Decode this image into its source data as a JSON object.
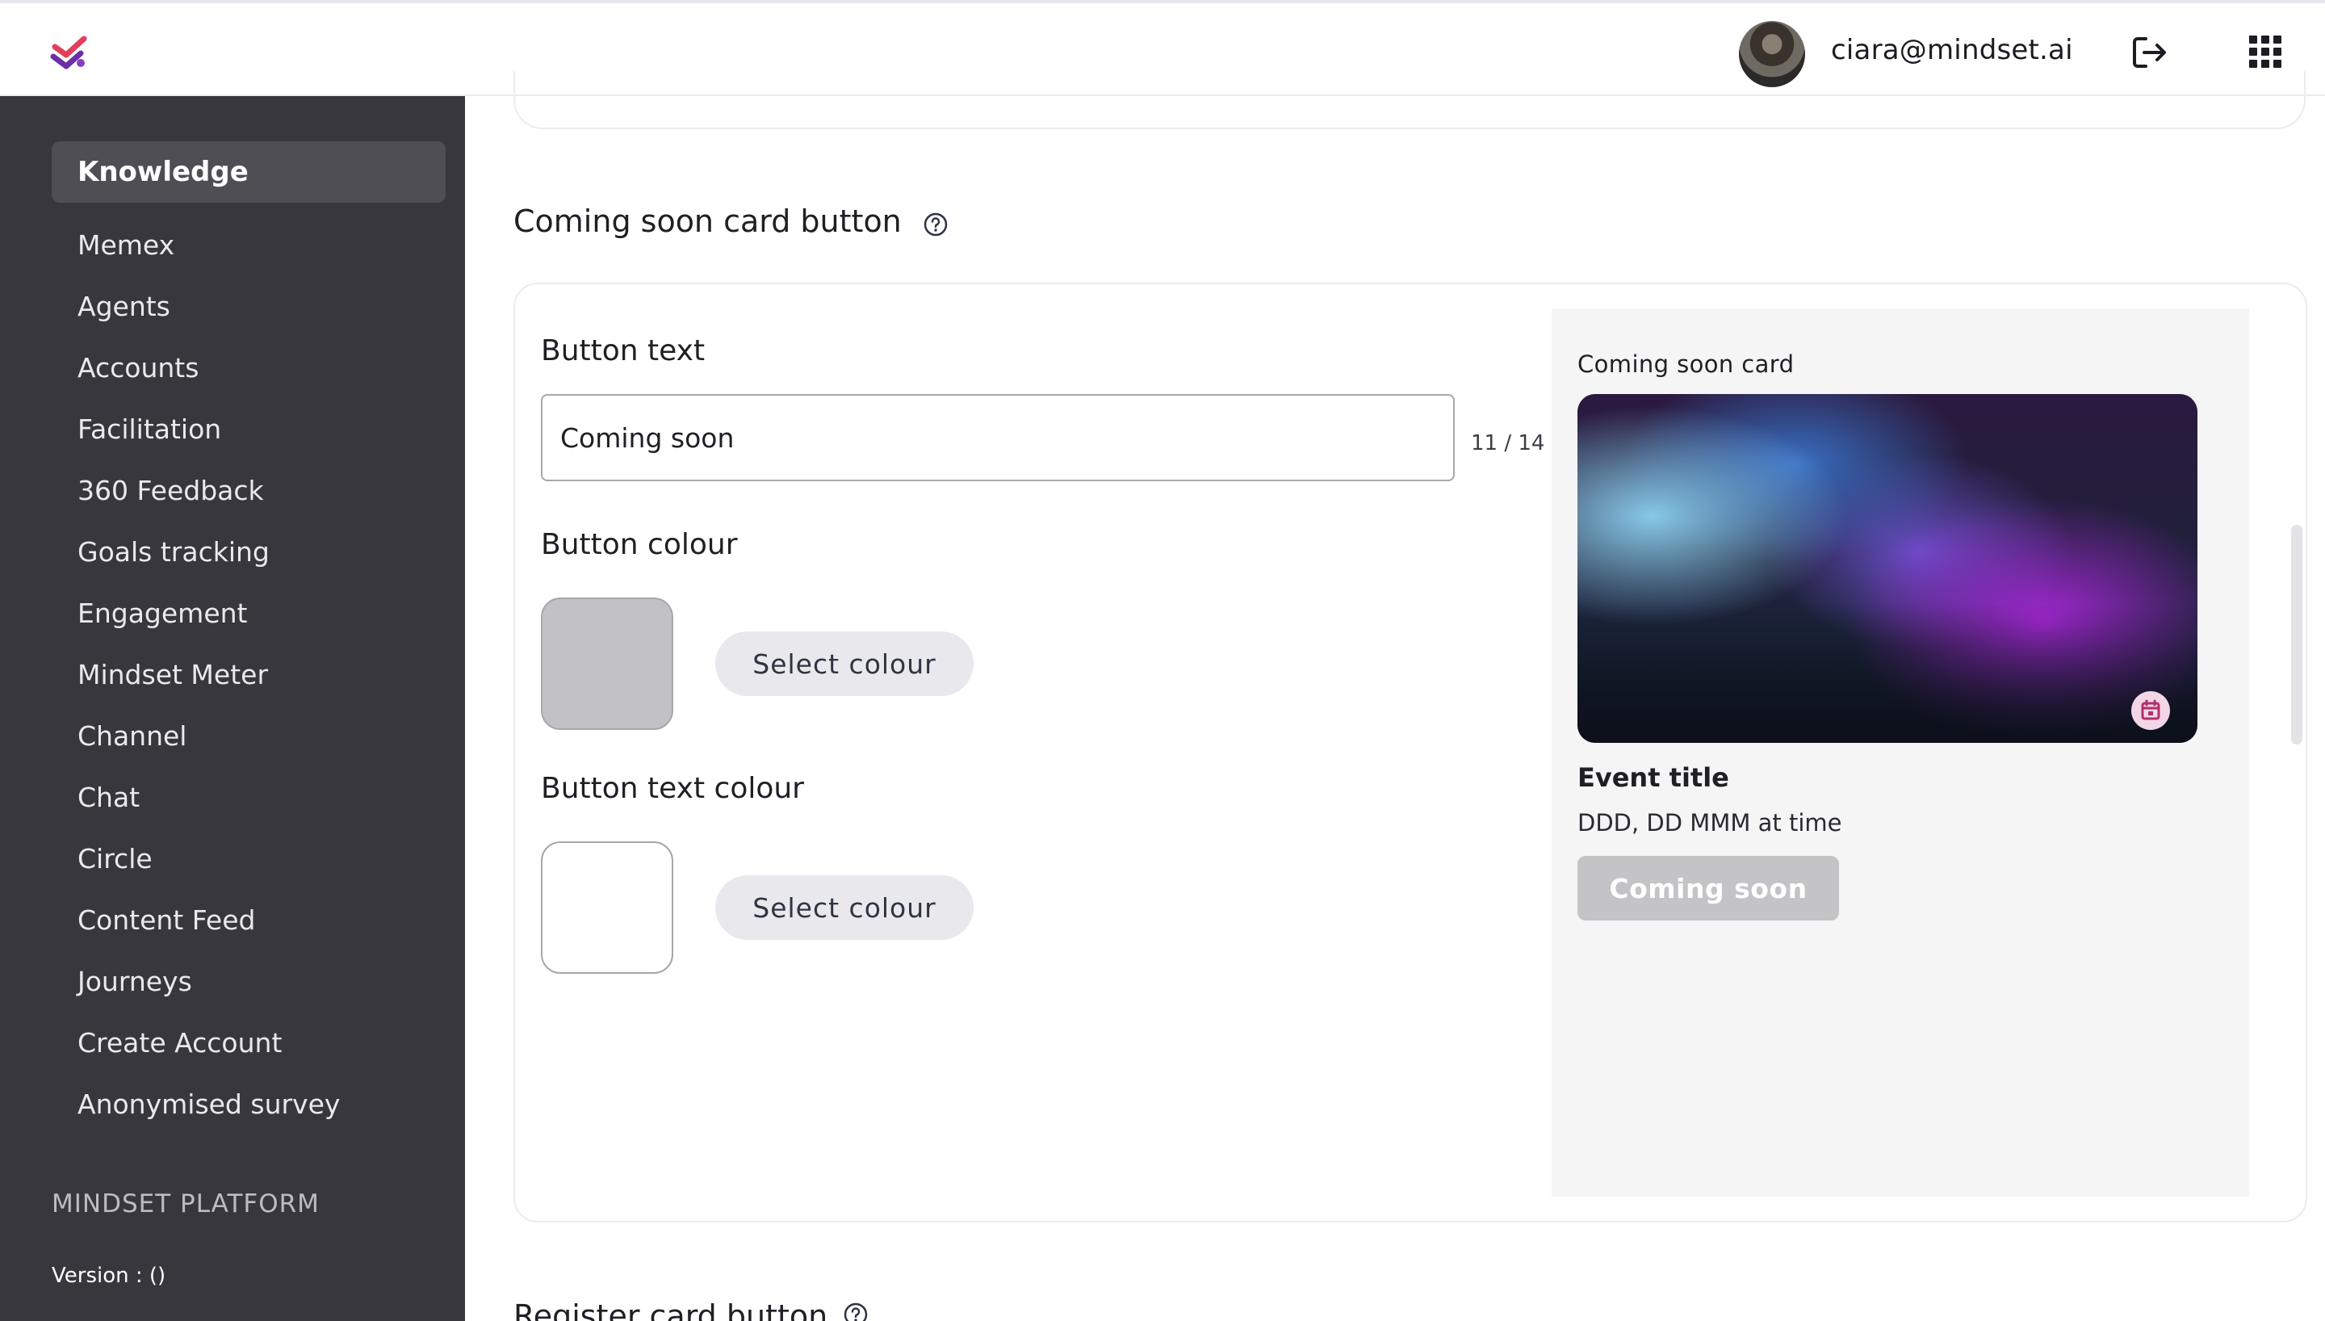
{
  "header": {
    "user_email": "ciara@mindset.ai",
    "logo_icon": "mindset-logo-icon",
    "logout_icon": "logout-icon",
    "apps_icon": "apps-grid-icon"
  },
  "sidebar": {
    "active_item": "Knowledge",
    "items": [
      {
        "label": "Memex"
      },
      {
        "label": "Agents"
      },
      {
        "label": "Accounts"
      },
      {
        "label": "Facilitation"
      },
      {
        "label": "360 Feedback"
      },
      {
        "label": "Goals tracking"
      },
      {
        "label": "Engagement"
      },
      {
        "label": "Mindset Meter"
      },
      {
        "label": "Channel"
      },
      {
        "label": "Chat"
      },
      {
        "label": "Circle"
      },
      {
        "label": "Content Feed"
      },
      {
        "label": "Journeys"
      },
      {
        "label": "Create Account"
      },
      {
        "label": "Anonymised survey"
      }
    ],
    "platform_label": "MINDSET PLATFORM",
    "version_label": "Version :  ()"
  },
  "section": {
    "title": "Coming soon card button",
    "button_text_label": "Button text",
    "button_text_value": "Coming soon",
    "char_counter": "11 / 14",
    "button_colour_label": "Button colour",
    "button_colour": "#c2c2c5",
    "button_text_colour_label": "Button text colour",
    "button_text_colour": "#ffffff",
    "select_colour_label": "Select colour"
  },
  "preview": {
    "label": "Coming soon card",
    "event_title": "Event title",
    "event_date": "DDD, DD MMM at time",
    "button_label": "Coming soon"
  },
  "next_section": {
    "title": "Register card button"
  },
  "colors": {
    "sidebar_bg": "#38373d",
    "sidebar_active_bg": "#4f4e55",
    "preview_bg": "#f5f5f6",
    "accent_purple": "#aa28dc"
  }
}
